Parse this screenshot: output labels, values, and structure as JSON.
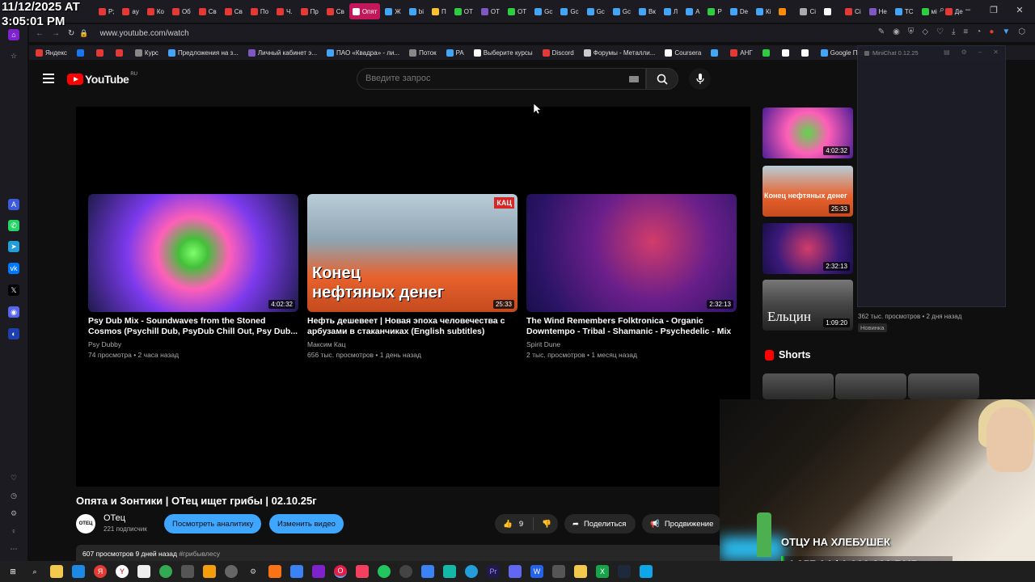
{
  "overlay": {
    "datetime_line1": "11/12/2025 AT",
    "datetime_line2": "3:05:01 PM",
    "stream_title": "ОТЦУ НА ХЛЕБУШЕК",
    "donation": "4 357.14 / 1 000 000 RUB"
  },
  "browser": {
    "tabs": [
      {
        "label": "Р;",
        "color": "#e53935"
      },
      {
        "label": "ay",
        "color": "#e53935"
      },
      {
        "label": "Ко",
        "color": "#e53935"
      },
      {
        "label": "Об",
        "color": "#e53935"
      },
      {
        "label": "Св",
        "color": "#e53935"
      },
      {
        "label": "Св",
        "color": "#e53935"
      },
      {
        "label": "По",
        "color": "#e53935"
      },
      {
        "label": "Ч.",
        "color": "#e53935"
      },
      {
        "label": "Пр",
        "color": "#e53935"
      },
      {
        "label": "Св",
        "color": "#e53935"
      },
      {
        "label": "Опят",
        "color": "#ffffff",
        "active": true
      },
      {
        "label": "Ж",
        "color": "#42a5f5"
      },
      {
        "label": "bi",
        "color": "#42a5f5"
      },
      {
        "label": "П",
        "color": "#fbc02d"
      },
      {
        "label": "ОТ",
        "color": "#2ecc40"
      },
      {
        "label": "ОТ",
        "color": "#7e57c2"
      },
      {
        "label": "ОТ",
        "color": "#2ecc40"
      },
      {
        "label": "Gc",
        "color": "#42a5f5"
      },
      {
        "label": "Gc",
        "color": "#42a5f5"
      },
      {
        "label": "Gc",
        "color": "#42a5f5"
      },
      {
        "label": "Gc",
        "color": "#42a5f5"
      },
      {
        "label": "Вк",
        "color": "#42a5f5"
      },
      {
        "label": "Л",
        "color": "#42a5f5"
      },
      {
        "label": "А",
        "color": "#42a5f5"
      },
      {
        "label": "Р",
        "color": "#2ecc40"
      },
      {
        "label": "De",
        "color": "#42a5f5"
      },
      {
        "label": "Кі",
        "color": "#42a5f5"
      },
      {
        "label": "",
        "color": "#fb8c00"
      },
      {
        "label": "Сі",
        "color": "#aaaaaa"
      },
      {
        "label": "",
        "color": "#ffffff"
      },
      {
        "label": "Сі",
        "color": "#e53935"
      },
      {
        "label": "Не",
        "color": "#7e57c2"
      },
      {
        "label": "ТС",
        "color": "#42a5f5"
      },
      {
        "label": "мі",
        "color": "#2ecc40"
      },
      {
        "label": "Де",
        "color": "#e53935"
      }
    ],
    "url": "www.youtube.com/watch",
    "bookmarks": [
      {
        "label": "Яндекс",
        "color": "#e53935"
      },
      {
        "label": "",
        "color": "#1877f2"
      },
      {
        "label": "",
        "color": "#e53935"
      },
      {
        "label": "",
        "color": "#e53935"
      },
      {
        "label": "Курс",
        "color": "#888888"
      },
      {
        "label": "Предложения на з...",
        "color": "#42a5f5"
      },
      {
        "label": "Личный кабинет э...",
        "color": "#7e57c2"
      },
      {
        "label": "ПАО «Квадра» - ли...",
        "color": "#42a5f5"
      },
      {
        "label": "Поток",
        "color": "#888888"
      },
      {
        "label": "РА",
        "color": "#42a5f5"
      },
      {
        "label": "Выберите курсы",
        "color": "#ffffff"
      },
      {
        "label": "Discord",
        "color": "#e53935"
      },
      {
        "label": "Форумы - Металли...",
        "color": "#cccccc"
      },
      {
        "label": "Coursera",
        "color": "#ffffff"
      },
      {
        "label": "",
        "color": "#42a5f5"
      },
      {
        "label": "АНГ",
        "color": "#e53935"
      },
      {
        "label": "",
        "color": "#2ecc40"
      },
      {
        "label": "",
        "color": "#ffffff"
      },
      {
        "label": "",
        "color": "#ffffff"
      },
      {
        "label": "Google Переводчик",
        "color": "#42a5f5"
      }
    ]
  },
  "youtube": {
    "logo_text": "YouTube",
    "logo_cc": "RU",
    "search_placeholder": "Введите запрос",
    "endscreen": [
      {
        "title": "Psy Dub Mix - Soundwaves from the Stoned Cosmos (Psychill Dub, PsyDub Chill Out, Psy Dub...",
        "channel": "Psy Dubby",
        "meta": "74 просмотра • 2 часа назад",
        "duration": "4:02:32"
      },
      {
        "title": "Нефть дешевеет | Новая эпоха человечества с арбузами в стаканчиках (English subtitles)",
        "channel": "Максим Кац",
        "meta": "656 тыс. просмотров • 1 день назад",
        "duration": "25:33",
        "badge": "КАЦ",
        "overlay_text_1": "Конец",
        "overlay_text_2": "нефтяных денег"
      },
      {
        "title": "The Wind Remembers Folktronica - Organic Downtempo - Tribal - Shamanic - Psychedelic - Mix",
        "channel": "Spirit Dune",
        "meta": "2 тыс. просмотров • 1 месяц назад",
        "duration": "2:32:13"
      }
    ],
    "video_title": "Опята и Зонтики | ОТец ищет грибы | 02.10.25г",
    "channel_name": "ОТец",
    "channel_subs": "221 подписчик",
    "btn_analytics": "Посмотреть аналитику",
    "btn_edit": "Изменить видео",
    "likes": "9",
    "btn_share": "Поделиться",
    "btn_promote": "Продвижение",
    "desc_meta": "607 просмотров  9 дней назад",
    "desc_tag": "#грибывлесу",
    "sidebar": {
      "items": [
        {
          "duration": "4:02:32"
        },
        {
          "duration": "25:33",
          "overlay_text": "Конец нефтяных денег"
        },
        {
          "duration": "2:32:13"
        },
        {
          "duration": "1:09:20",
          "overlay_text": "Ельцин"
        }
      ],
      "meta": "362 тыс. просмотров • 2 дня назад",
      "badge": "Новинка",
      "shorts_label": "Shorts"
    }
  },
  "minichat": {
    "title": "MiniChat 0.12.25"
  }
}
